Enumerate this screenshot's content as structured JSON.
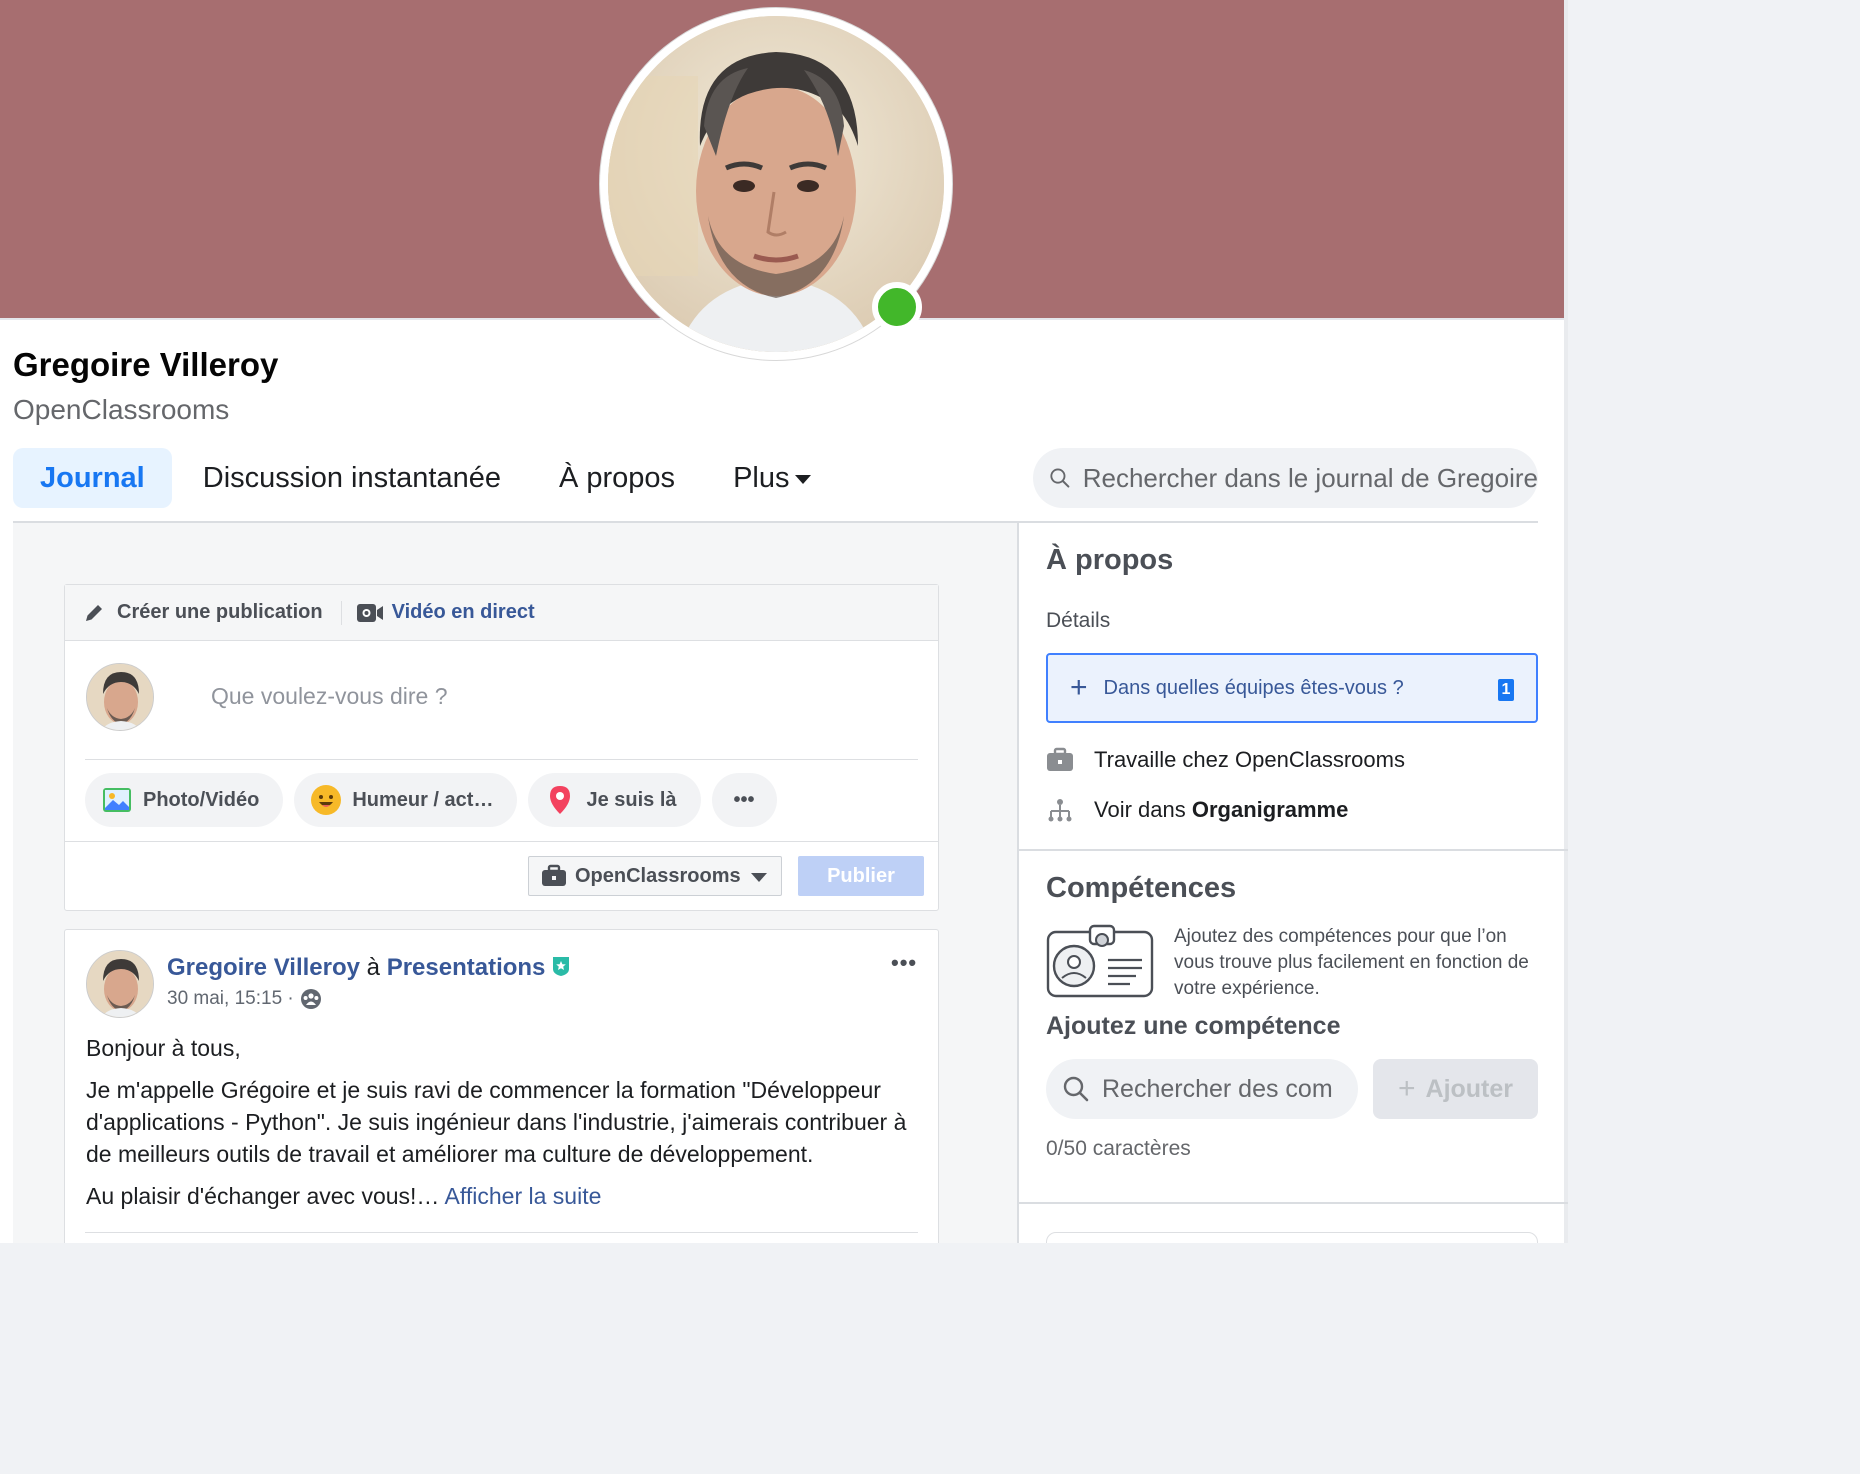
{
  "profile": {
    "name": "Gregoire Villeroy",
    "organization": "OpenClassrooms"
  },
  "tabs": [
    {
      "label": "Journal",
      "active": true
    },
    {
      "label": "Discussion instantanée"
    },
    {
      "label": "À propos"
    },
    {
      "label": "Plus"
    }
  ],
  "journal_search": {
    "placeholder": "Rechercher dans le journal de Gregoire"
  },
  "composer": {
    "create_label": "Créer une publication",
    "live_label": "Vidéo en direct",
    "placeholder": "Que voulez-vous dire ?",
    "actions": [
      "Photo/Vidéo",
      "Humeur / act…",
      "Je suis là",
      "•••"
    ],
    "audience": "OpenClassrooms",
    "publish_label": "Publier"
  },
  "post": {
    "author": "Gregoire Villeroy",
    "connector": "à",
    "group": "Presentations",
    "timestamp": "30 mai, 15:15 ·",
    "more": "•••",
    "paragraphs": [
      "Bonjour à tous,",
      "Je m'appelle Grégoire et je suis ravi de commencer la formation \"Développeur d'applications - Python\". Je suis ingénieur dans l'industrie, j'aimerais contribuer à de meilleurs outils de travail et améliorer ma culture de développement.",
      "Au plaisir d'échanger avec vous!…"
    ],
    "read_more": "Afficher la suite"
  },
  "about": {
    "title": "À propos",
    "details_label": "Détails",
    "teams_prompt": "Dans quelles équipes êtes-vous ?",
    "teams_badge": "1",
    "works_at": "Travaille chez OpenClassrooms",
    "org_chart_prefix": "Voir dans",
    "org_chart_link": "Organigramme"
  },
  "skills": {
    "title": "Compétences",
    "description": "Ajoutez des compétences pour que l’on vous trouve plus facilement en fonction de votre expérience.",
    "add_title": "Ajoutez une compétence",
    "search_placeholder": "Rechercher des com",
    "add_button": "Ajouter",
    "char_count": "0/50 caractères"
  },
  "colors": {
    "cover": "#a76e70",
    "online": "#42b72a",
    "link": "#385898",
    "accent": "#1877f2"
  }
}
